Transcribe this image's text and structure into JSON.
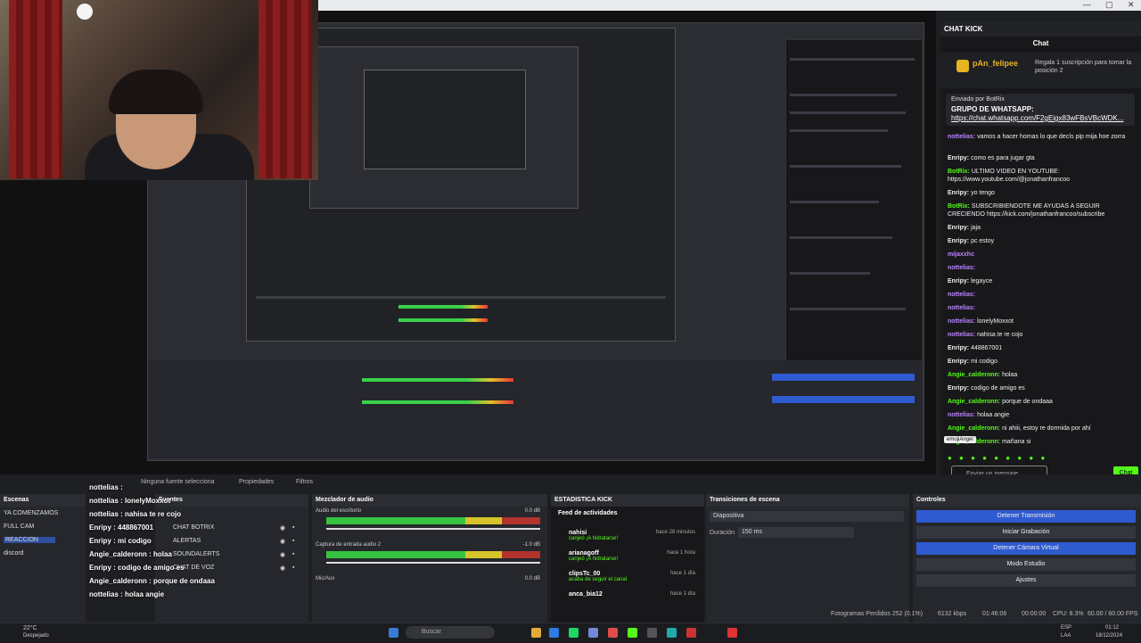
{
  "webcam": {},
  "chat": {
    "title": "CHAT KICK",
    "subtitle": "Chat",
    "gift_user": "pAn_felipee",
    "gift_msg": "Regala 1 suscripción para tomar la posición 2",
    "pinned_by": "Enviado por BotRix",
    "pinned_title": "GRUPO DE WHATSAPP:",
    "pinned_link": "https://chat.whatsapp.com/F2gEigx83wFBsVBcWDK...",
    "messages": [
      {
        "user": "nottelias:",
        "text": "vamos a hacer homas lo que decís pip mija hoe zorra",
        "cls": "purple"
      },
      {
        "user": "Enripy:",
        "text": "como es para jugar gta",
        "cls": ""
      },
      {
        "user": "BotRix:",
        "text": "ULTIMO VIDEO EN YOUTUBE: https://www.youtube.com/@jonathanfrancoo",
        "cls": "gr"
      },
      {
        "user": "Enripy:",
        "text": "yo tengo",
        "cls": ""
      },
      {
        "user": "BotRix:",
        "text": "SUBSCRIBIENDOTE ME AYUDAS A SEGUIR CRECIENDO https://kick.com/jonathanfrancoo/subscribe",
        "cls": "gr"
      },
      {
        "user": "Enripy:",
        "text": "jaja",
        "cls": ""
      },
      {
        "user": "Enripy:",
        "text": "pc estoy",
        "cls": ""
      },
      {
        "user": "mijaxxhc",
        "text": "",
        "cls": "purple"
      },
      {
        "user": "nottelias:",
        "text": "",
        "cls": "purple"
      },
      {
        "user": "Enripy:",
        "text": "legayce",
        "cls": ""
      },
      {
        "user": "nottelias:",
        "text": "",
        "cls": "purple"
      },
      {
        "user": "nottelias:",
        "text": "",
        "cls": "purple"
      },
      {
        "user": "nottelias:",
        "text": "lonelyMoxxot",
        "cls": "purple"
      },
      {
        "user": "nottelias:",
        "text": "nahisa te re cojo",
        "cls": "purple"
      },
      {
        "user": "Enripy:",
        "text": "448867001",
        "cls": ""
      },
      {
        "user": "Enripy:",
        "text": "mi codigo",
        "cls": ""
      },
      {
        "user": "Angie_calderonn:",
        "text": "holaa",
        "cls": "gr"
      },
      {
        "user": "Enripy:",
        "text": "codigo de amigo es",
        "cls": ""
      },
      {
        "user": "Angie_calderonn:",
        "text": "porque de ondaaa",
        "cls": "gr"
      },
      {
        "user": "nottelias:",
        "text": "holaa angie",
        "cls": "purple"
      },
      {
        "user": "Angie_calderonn:",
        "text": "ni ahiii, estoy re dormida por ahí",
        "cls": "gr"
      },
      {
        "user": "Angie_calderonn:",
        "text": "mañana si",
        "cls": "gr"
      }
    ],
    "tooltip": "emojiAngel",
    "input_placeholder": "Enviar un mensaje",
    "send": "Chat"
  },
  "obs": {
    "no_source": "Ninguna fuente selecciona",
    "properties": "Propiedades",
    "filters": "Filtros",
    "scenes_title": "Escenas",
    "scenes": [
      "YA COMENZAMOS",
      "FULL CAM",
      "REACCION",
      "discord"
    ],
    "selected_scene": 2,
    "sources_title": "Fuentes",
    "sources": [
      "CHAT BOTRIX",
      "ALERTAS",
      "SOUNDALERTS",
      "CHAT DE VOZ"
    ],
    "mixer_title": "Mezclador de audio",
    "mixer": [
      {
        "name": "Audio del escritorio",
        "db": "0.0 dB"
      },
      {
        "name": "Captura de entrada audio 2",
        "db": "-1.0 dB"
      },
      {
        "name": "Mic/Aux",
        "db": "0.0 dB"
      }
    ],
    "kick_title": "ESTADISTICA KICK",
    "feed_title": "Feed de actividades",
    "feed": [
      {
        "name": "nahisi",
        "desc": "canjeó ¡A hidratarse!",
        "time": "hace 28 minutos"
      },
      {
        "name": "arianagoff",
        "desc": "canjeó ¡A hidratarse!",
        "time": "hace 1 hora"
      },
      {
        "name": "clipsTc_00",
        "desc": "acaba de seguir el canal",
        "time": "hace 1 día"
      },
      {
        "name": "anca_bia12",
        "desc": "",
        "time": "hace 1 día"
      }
    ],
    "transitions_title": "Transiciones de escena",
    "transition": "Diapositiva",
    "duration_label": "Duración",
    "duration": "150 ms",
    "controls_title": "Controles",
    "controls": [
      "Detener Transmisión",
      "Iniciar Grabación",
      "Detener Cámara Virtual",
      "Modo Estudio",
      "Ajustes"
    ],
    "status": {
      "dropped": "Fotogramas Perdidos 252 (0.1%)",
      "kbps": "6132 kbps",
      "live": "01:46:06",
      "rec": "00:00:00",
      "cpu": "CPU: 8.3%",
      "fps": "60.00 / 60.00 FPS"
    }
  },
  "overlay_chat": [
    "nottelias : ",
    "nottelias : lonelyMoxxot",
    "nottelias : nahisa te re cojo",
    "Enripy : 448867001",
    "Enripy : mi codigo",
    "Angie_calderonn : holaa",
    "Enripy : codigo de amigo es",
    "Angie_calderonn : porque de ondaaa",
    "nottelias : holaa angie"
  ],
  "taskbar": {
    "weather_temp": "22°C",
    "weather_desc": "Despejado",
    "search": "Buscar",
    "lang": "ESP",
    "region": "LAA",
    "time": "01:12",
    "date": "18/12/2024"
  },
  "colors": {
    "kick_green": "#53fc18",
    "accent_blue": "#2f5bd0"
  }
}
